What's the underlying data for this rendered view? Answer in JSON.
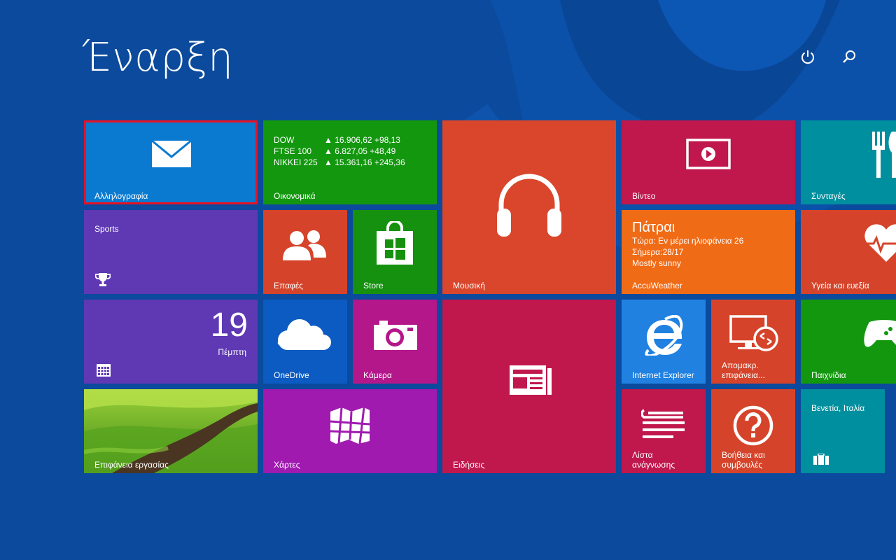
{
  "page_title": "Έναρξη",
  "icons": {
    "power": "power-icon",
    "search": "search-icon"
  },
  "colors": {
    "background": "#0b4a9c",
    "mail": "#0a7ad0",
    "finance": "#13970f",
    "music": "#d9462c",
    "video": "#c0174c",
    "recipes": "#008f9e",
    "sports": "#5f38b4",
    "people": "#d5442a",
    "store": "#15910f",
    "weather": "#f06b16",
    "health": "#d5442a",
    "calendar": "#5f38b4",
    "onedrive": "#0b5bc2",
    "camera": "#b3178a",
    "news": "#c0174c",
    "ie": "#2081e1",
    "remote": "#d5442a",
    "games": "#13970f",
    "maps": "#a01ab0",
    "reading": "#c0174c",
    "help": "#d5442a",
    "travel": "#008f9e",
    "selection": "#e81123"
  },
  "tiles": {
    "mail": {
      "label": "Αλληλογραφία",
      "icon": "mail-icon"
    },
    "finance": {
      "label": "Οικονομικά",
      "rows": [
        {
          "name": "DOW",
          "value": "▲ 16.906,62 +98,13"
        },
        {
          "name": "FTSE 100",
          "value": "▲ 6.827,05 +48,49"
        },
        {
          "name": "NIKKEI 225",
          "value": "▲ 15.361,16 +245,36"
        }
      ]
    },
    "music": {
      "label": "Μουσική",
      "icon": "headphones-icon"
    },
    "video": {
      "label": "Βίντεο",
      "icon": "video-play-icon"
    },
    "recipes": {
      "label": "Συνταγές",
      "icon": "fork-knife-icon"
    },
    "sports": {
      "title": "Sports",
      "icon": "trophy-icon"
    },
    "people": {
      "label": "Επαφές",
      "icon": "people-icon"
    },
    "store": {
      "label": "Store",
      "icon": "store-bag-icon"
    },
    "weather": {
      "city": "Πάτραι",
      "now": "Τώρα: Εν μέρει ηλιοφάνεια 26",
      "today": "Σήμερα:28/17",
      "condition": "Mostly sunny",
      "label": "AccuWeather"
    },
    "health": {
      "label": "Υγεία και ευεξία",
      "icon": "heart-pulse-icon"
    },
    "calendar": {
      "day": "19",
      "weekday": "Πέμπτη",
      "icon": "calendar-grid-icon"
    },
    "onedrive": {
      "label": "OneDrive",
      "icon": "cloud-icon"
    },
    "camera": {
      "label": "Κάμερα",
      "icon": "camera-icon"
    },
    "news": {
      "label": "Ειδήσεις",
      "icon": "newspaper-icon"
    },
    "ie": {
      "label": "Internet Explorer",
      "icon": "ie-logo-icon"
    },
    "remote": {
      "label": "Απομακρ.\nεπιφάνεια...",
      "icon": "remote-desktop-icon"
    },
    "games": {
      "label": "Παιχνίδια",
      "icon": "gamepad-icon"
    },
    "desktop": {
      "label": "Επιφάνεια εργασίας"
    },
    "maps": {
      "label": "Χάρτες",
      "icon": "map-icon"
    },
    "reading": {
      "label": "Λίστα\nανάγνωσης",
      "icon": "reading-list-icon"
    },
    "help": {
      "label": "Βοήθεια και\nσυμβουλές",
      "icon": "question-icon"
    },
    "travel": {
      "title": "Βενετία, Ιταλία",
      "icon": "suitcase-icon"
    }
  }
}
